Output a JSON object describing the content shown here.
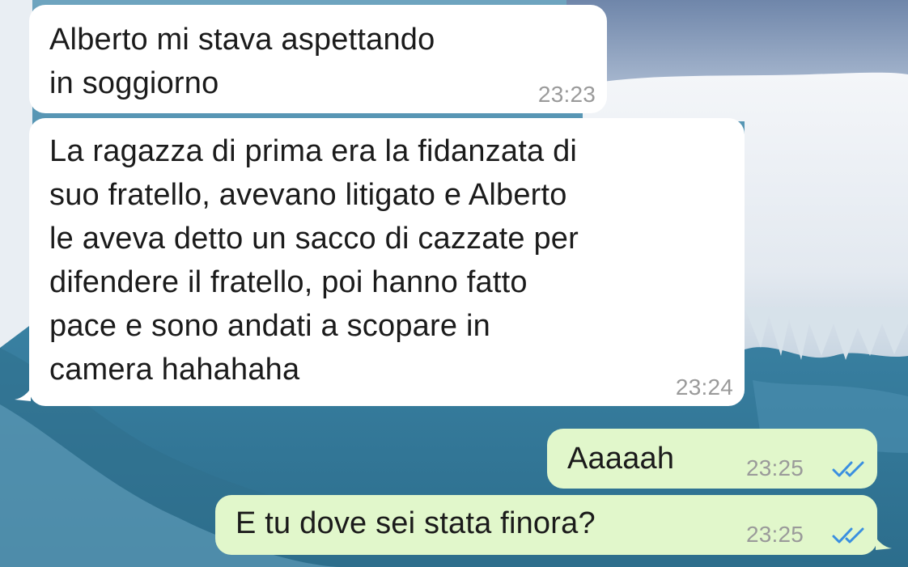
{
  "chat": {
    "messages": [
      {
        "direction": "incoming",
        "text": "Alberto mi stava aspettando\nin soggiorno",
        "time": "23:23"
      },
      {
        "direction": "incoming",
        "text": "La ragazza di prima era la fidanzata di\nsuo fratello, avevano litigato e Alberto\nle aveva detto un sacco di cazzate per\ndifendere il fratello, poi hanno fatto\npace e sono andati a scopare in\ncamera hahahaha",
        "time": "23:24"
      },
      {
        "direction": "outgoing",
        "text": "Aaaaah",
        "time": "23:25",
        "status_icon": "double-check-read-icon"
      },
      {
        "direction": "outgoing",
        "text": "E tu dove sei stata finora?",
        "time": "23:25",
        "status_icon": "double-check-read-icon"
      }
    ]
  },
  "colors": {
    "incoming_bubble": "#ffffff",
    "outgoing_bubble": "#e1f7cb",
    "timestamp": "#9a9a9a",
    "read_ticks": "#3a8fe0"
  }
}
